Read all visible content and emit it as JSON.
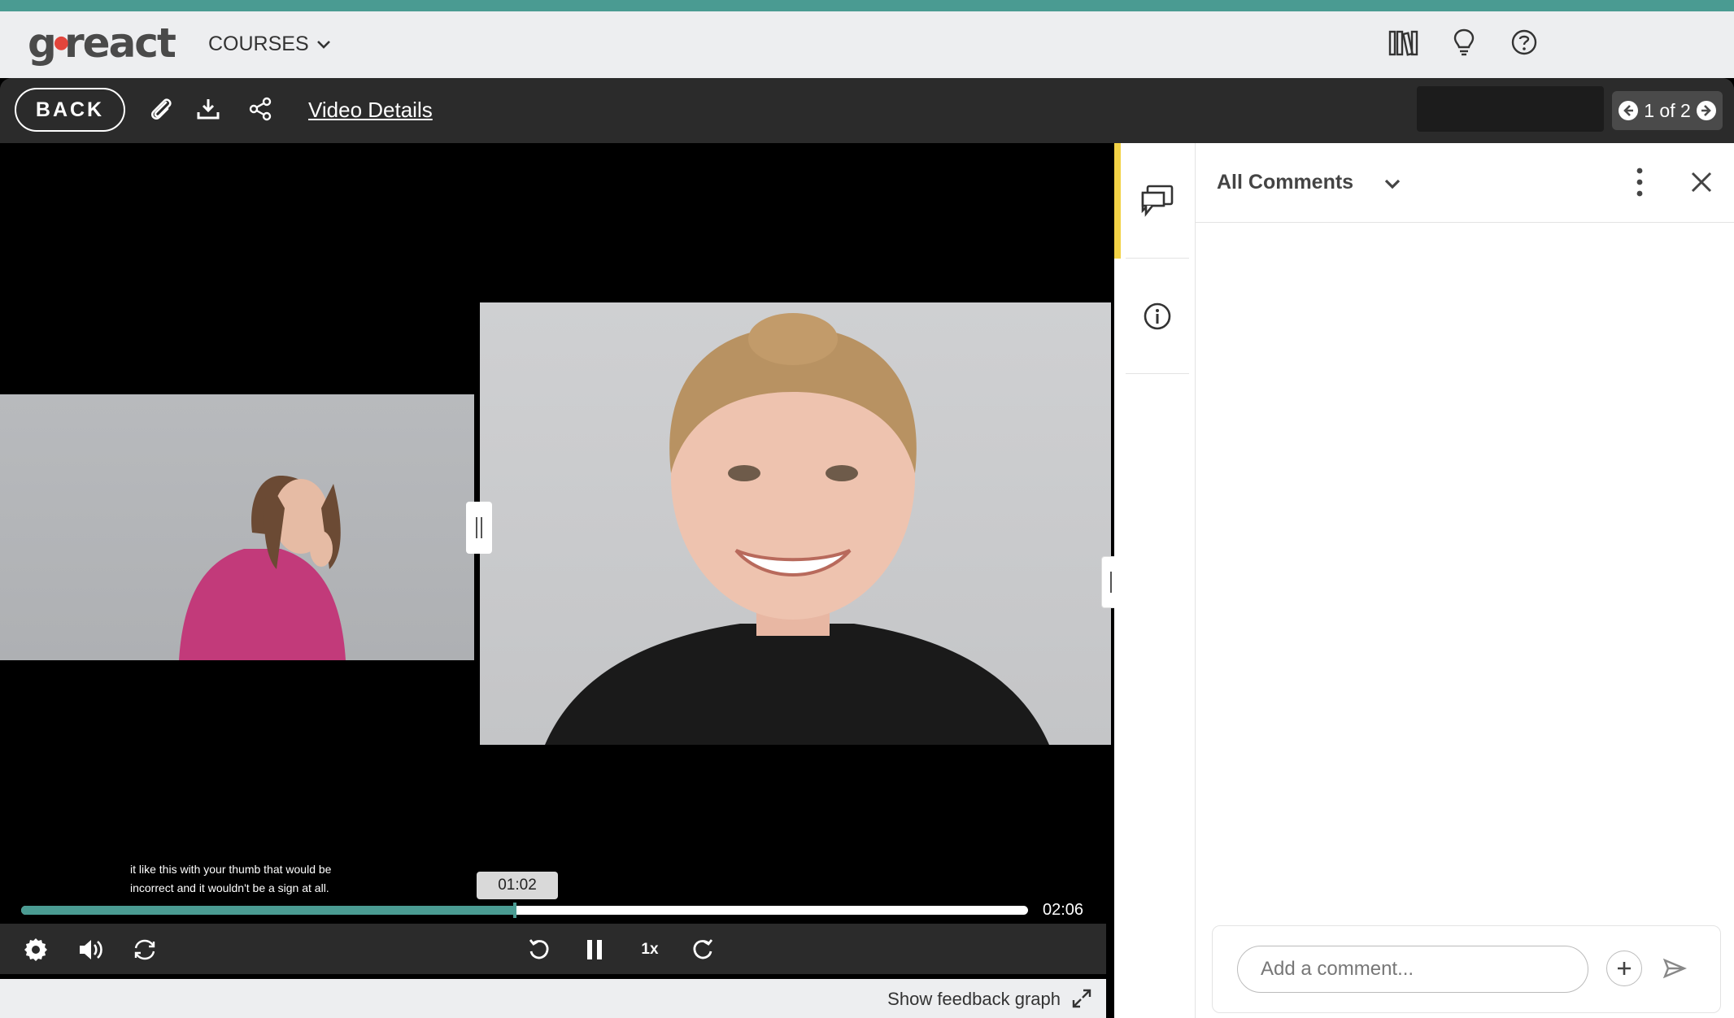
{
  "app": {
    "logo_text": "goreact"
  },
  "topbar": {
    "courses_label": "COURSES"
  },
  "toolbar": {
    "back_label": "BACK",
    "video_details_label": "Video Details",
    "pager_label": "1 of 2"
  },
  "player": {
    "caption_line1": "it like this with your thumb that would be",
    "caption_line2": "incorrect and it wouldn't be a sign at all.",
    "current_time": "01:02",
    "duration": "02:06",
    "progress": 0.49,
    "speed_label": "1x"
  },
  "feedback": {
    "show_graph_label": "Show feedback graph"
  },
  "comments": {
    "filter_label": "All Comments",
    "input_placeholder": "Add a comment..."
  },
  "colors": {
    "accent": "#4a9b92",
    "active_tab": "#f2d246",
    "toolbar": "#2b2b2b"
  }
}
